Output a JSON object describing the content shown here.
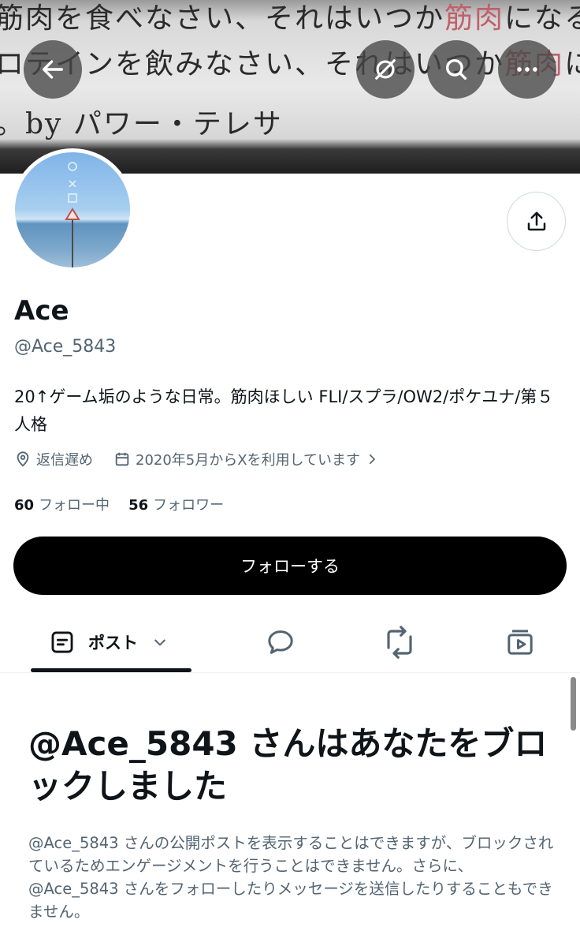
{
  "banner": {
    "line1": "筋肉を食べなさい、それはいつか",
    "line1_red": "筋肉",
    "line1_tail": "になるから。",
    "line2": "ロテインを飲みなさい、それはいつか",
    "line2_red": "筋肉",
    "line2_tail": "になる",
    "line3": "。by パワー・テレサ"
  },
  "icons": {
    "back": "back-arrow-icon",
    "grok": "grok-icon",
    "search": "search-icon",
    "more": "more-icon",
    "share": "share-icon",
    "location": "location-icon",
    "calendar": "calendar-icon",
    "posts": "posts-icon",
    "replies": "reply-icon",
    "reposts": "repost-icon",
    "media": "media-icon"
  },
  "profile": {
    "name": "Ace",
    "handle": "@Ace_5843",
    "bio": "20↑ゲーム垢のような日常。筋肉ほしい FLI/スプラ/OW2/ポケユナ/第５人格",
    "location": "返信遅め",
    "joined": "2020年5月からXを利用しています",
    "following_count": "60",
    "following_label": "フォロー中",
    "followers_count": "56",
    "followers_label": "フォロワー",
    "follow_button": "フォローする"
  },
  "tabs": {
    "posts_label": "ポスト"
  },
  "blocked": {
    "title": "@Ace_5843 さんはあなたをブロックしました",
    "description": "@Ace_5843 さんの公開ポストを表示することはできますが、ブロックされているためエンゲージメントを行うことはできません。さらに、@Ace_5843 さんをフォローしたりメッセージを送信したりすることもできません。"
  },
  "colors": {
    "text": "#0f1419",
    "secondary": "#536471",
    "button": "#000000"
  }
}
